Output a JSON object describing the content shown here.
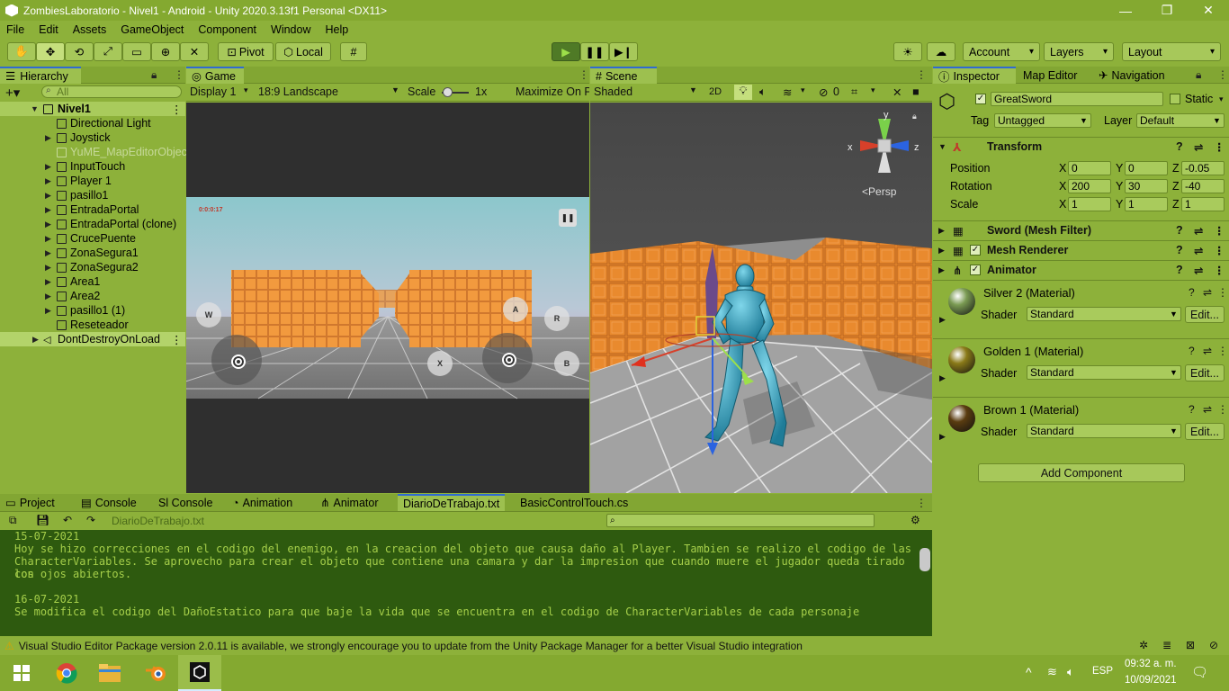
{
  "window": {
    "title": "ZombiesLaboratorio - Nivel1 - Android - Unity 2020.3.13f1 Personal <DX11>"
  },
  "menu": [
    "File",
    "Edit",
    "Assets",
    "GameObject",
    "Component",
    "Window",
    "Help"
  ],
  "toolbar": {
    "pivot": "Pivot",
    "local": "Local",
    "account": "Account",
    "layers": "Layers",
    "layout": "Layout"
  },
  "hierarchy": {
    "tab": "Hierarchy",
    "search_placeholder": "All",
    "scene": "Nivel1",
    "items": [
      {
        "label": "Directional Light",
        "expandable": false,
        "dim": false
      },
      {
        "label": "Joystick",
        "expandable": true,
        "dim": false
      },
      {
        "label": "YuME_MapEditorObjec",
        "expandable": false,
        "dim": true
      },
      {
        "label": "InputTouch",
        "expandable": true,
        "dim": false
      },
      {
        "label": "Player 1",
        "expandable": true,
        "dim": false
      },
      {
        "label": "pasillo1",
        "expandable": true,
        "dim": false
      },
      {
        "label": "EntradaPortal",
        "expandable": true,
        "dim": false
      },
      {
        "label": "EntradaPortal (clone)",
        "expandable": true,
        "dim": false
      },
      {
        "label": "CrucePuente",
        "expandable": true,
        "dim": false
      },
      {
        "label": "ZonaSegura1",
        "expandable": true,
        "dim": false
      },
      {
        "label": "ZonaSegura2",
        "expandable": true,
        "dim": false
      },
      {
        "label": "Area1",
        "expandable": true,
        "dim": false
      },
      {
        "label": "Area2",
        "expandable": true,
        "dim": false
      },
      {
        "label": "pasillo1 (1)",
        "expandable": true,
        "dim": false
      },
      {
        "label": "Reseteador",
        "expandable": false,
        "dim": false
      }
    ],
    "dontdestroy": "DontDestroyOnLoad"
  },
  "game": {
    "tab": "Game",
    "display": "Display 1",
    "aspect": "18:9 Landscape",
    "scale_label": "Scale",
    "scale_value": "1x",
    "maximize": "Maximize On P",
    "timer": "0:0:0:17",
    "buttons": {
      "w": "W",
      "a": "A",
      "r": "R",
      "x": "X",
      "b": "B"
    }
  },
  "scene": {
    "tab": "Scene",
    "shading": "Shaded",
    "mode2d": "2D",
    "hidden_count": "0",
    "persp": "Persp",
    "axes": {
      "x": "x",
      "y": "y",
      "z": "z"
    }
  },
  "inspector": {
    "tabs": [
      "Inspector",
      "Map Editor",
      "Navigation"
    ],
    "object_name": "GreatSword",
    "static_label": "Static",
    "tag_label": "Tag",
    "tag_value": "Untagged",
    "layer_label": "Layer",
    "layer_value": "Default",
    "transform": {
      "title": "Transform",
      "position": {
        "label": "Position",
        "x": "0",
        "y": "0",
        "z": "-0.05"
      },
      "rotation": {
        "label": "Rotation",
        "x": "200",
        "y": "30",
        "z": "-40"
      },
      "scale": {
        "label": "Scale",
        "x": "1",
        "y": "1",
        "z": "1"
      }
    },
    "components": [
      "Sword (Mesh Filter)",
      "Mesh Renderer",
      "Animator"
    ],
    "materials": [
      {
        "name": "Silver 2 (Material)",
        "shader_label": "Shader",
        "shader": "Standard",
        "edit": "Edit...",
        "color": "#7a9a52"
      },
      {
        "name": "Golden 1 (Material)",
        "shader_label": "Shader",
        "shader": "Standard",
        "edit": "Edit...",
        "color": "#8a7a18"
      },
      {
        "name": "Brown 1 (Material)",
        "shader_label": "Shader",
        "shader": "Standard",
        "edit": "Edit...",
        "color": "#5a3c10"
      }
    ],
    "add_component": "Add Component"
  },
  "bottom": {
    "tabs": [
      "Project",
      "Console",
      "Sl Console",
      "Animation",
      "Animator",
      "DiarioDeTrabajo.txt",
      "BasicControlTouch.cs"
    ],
    "filename": "DiarioDeTrabajo.txt",
    "lines": [
      "15-07-2021",
      "Hoy se hizo correcciones en el codigo del enemigo, en la creacion del objeto que causa daño al Player. Tambien se realizo el codigo de las",
      "CharacterVariables. Se aprovecho para crear el objeto que contiene una camara y dar la impresion que cuando muere el jugador queda tirado con",
      "los ojos abiertos.",
      "",
      "16-07-2021",
      "Se modifica el codigo del DañoEstatico para que baje la vida que se encuentra en el codigo de CharacterVariables de cada personaje"
    ]
  },
  "status": {
    "message": "Visual Studio Editor Package version 2.0.11 is available, we strongly encourage you to update from the Unity Package Manager for a better Visual Studio integration"
  },
  "taskbar": {
    "lang": "ESP",
    "time": "09:32 a. m.",
    "date": "10/09/2021"
  },
  "colors": {
    "accent": "#2f6bd1",
    "editor_green": "#8db13a",
    "text_area_bg": "#2e5a0f"
  }
}
